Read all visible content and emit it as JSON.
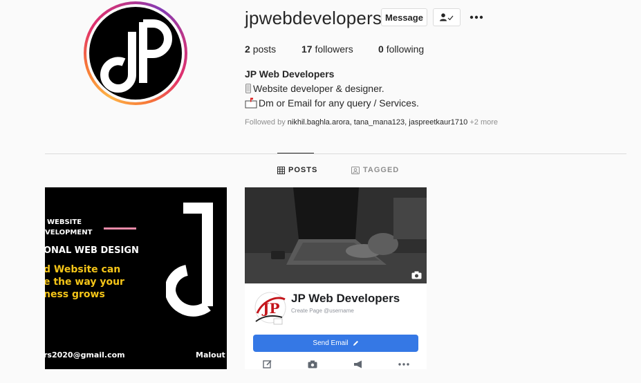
{
  "profile": {
    "username": "jpwebdevelopers",
    "message_label": "Message",
    "stats": {
      "posts_count": "2",
      "posts_label": "posts",
      "followers_count": "17",
      "followers_label": "followers",
      "following_count": "0",
      "following_label": "following"
    },
    "full_name": "JP Web Developers",
    "bio": [
      "Website developer & designer.",
      "Dm or Email for any query / Services."
    ],
    "followed_by_prefix": "Followed by",
    "followed_by_names": "nikhil.baghla.arora, tana_mana123, jaspreetkaur1710",
    "followed_by_more": "+2 more"
  },
  "tabs": [
    {
      "label": "POSTS",
      "icon": "grid-icon",
      "active": true
    },
    {
      "label": "TAGGED",
      "icon": "tag-icon",
      "active": false
    }
  ],
  "posts": {
    "post1": {
      "line1": "WEBSITE",
      "line2": "VELOPMENT",
      "line3": "ONAL WEB DESIGN",
      "line4": "d Website can",
      "line5": "e the way your",
      "line6": "ness grows",
      "email": "rs2020@gmail.com",
      "location": "Malout"
    },
    "post2": {
      "page_name": "JP Web Developers",
      "page_sub": "Create Page @username",
      "send_label": "Send Email"
    }
  },
  "colors": {
    "accent_yellow": "#f5c518",
    "accent_pink": "#e88aa8",
    "fb_blue": "#3578e5"
  }
}
